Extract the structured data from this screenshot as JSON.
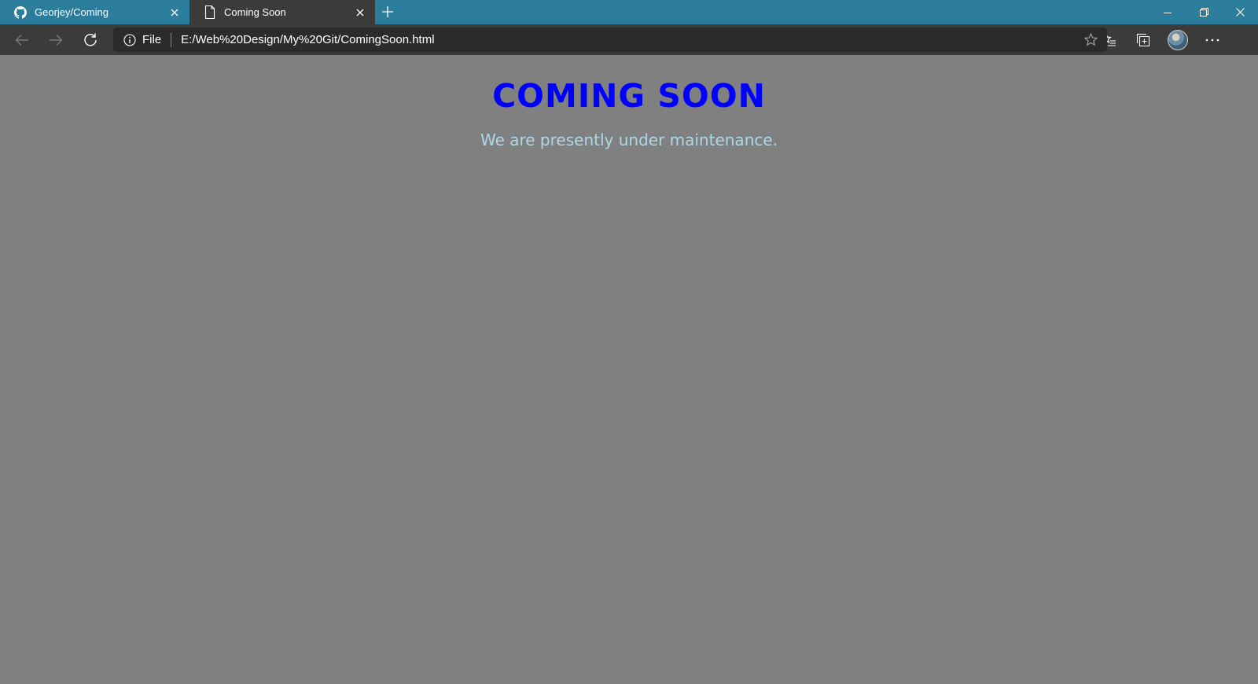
{
  "browser": {
    "tabs": [
      {
        "label": "Georjey/Coming",
        "icon": "github-icon",
        "active": false
      },
      {
        "label": "Coming Soon",
        "icon": "document-icon",
        "active": true
      }
    ],
    "address": {
      "scheme_label": "File",
      "url": "E:/Web%20Design/My%20Git/ComingSoon.html"
    },
    "colors": {
      "tabstrip": "#2b7d9b",
      "toolbar": "#3b3b3b",
      "addressbar": "#2b2b2b"
    }
  },
  "page": {
    "title": "COMING SOON",
    "subtitle": "We are presently under maintenance.",
    "colors": {
      "background": "#808080",
      "title": "#0000ff",
      "subtitle": "#add8e6"
    }
  }
}
